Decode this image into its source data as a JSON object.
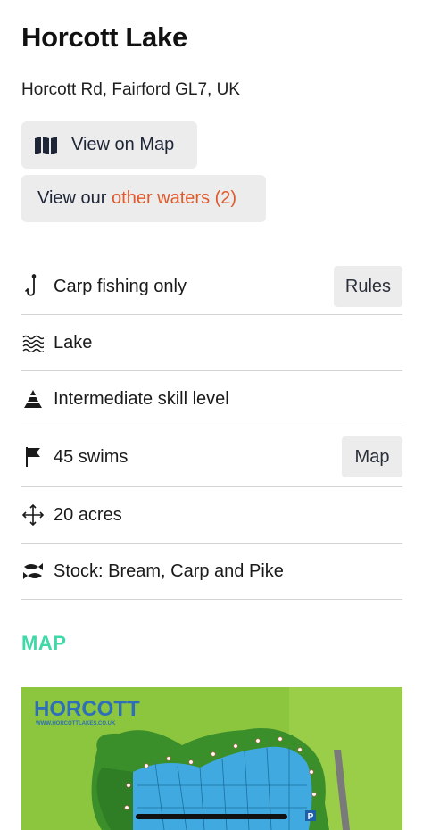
{
  "header": {
    "title": "Horcott Lake",
    "address": "Horcott Rd, Fairford GL7, UK"
  },
  "actions": {
    "view_on_map": "View on Map",
    "view_other_prefix": "View our ",
    "view_other_link": "other waters (2)"
  },
  "details": [
    {
      "icon": "fishing-hook-icon",
      "text": "Carp fishing only",
      "button": "Rules"
    },
    {
      "icon": "waves-icon",
      "text": "Lake"
    },
    {
      "icon": "skill-level-icon",
      "text": "Intermediate skill level"
    },
    {
      "icon": "flag-icon",
      "text": "45 swims",
      "button": "Map"
    },
    {
      "icon": "area-arrows-icon",
      "text": "20 acres"
    },
    {
      "icon": "fish-icon",
      "text": "Stock: Bream, Carp and Pike"
    }
  ],
  "map_section": {
    "heading": "MAP",
    "logo_text": "HORCOTT",
    "logo_url_text": "WWW.HORCOTTLAKES.CO.UK",
    "parking_label": "P"
  },
  "colors": {
    "accent_orange": "#e0592a",
    "map_heading_green": "#3fd9a8",
    "button_bg": "#ececec",
    "divider": "#d4d4d4"
  }
}
